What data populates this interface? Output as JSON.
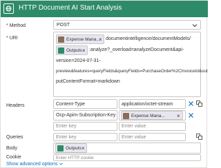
{
  "header": {
    "title": "HTTP Document AI Start Analysis"
  },
  "method": {
    "label": "Method",
    "required": "*",
    "value": "POST"
  },
  "uri": {
    "label": "URI",
    "required": "*",
    "token1": "Expense Mana...",
    "after_token1": "documentintelligence/documentModels/",
    "token2": "Outputs",
    "after_token2": ":analyze?_overload=analyzeDocument&api-",
    "line3": "version=2024-07-31-",
    "line4": "preview&features=queryFields&queryFields=PurchaseOrder%2CInvoiceId&out",
    "line5": "putContentFormat=markdown"
  },
  "headers": {
    "label": "Headers",
    "rows": [
      {
        "key": "Content-Type",
        "value": "application/octet-stream"
      },
      {
        "key": "Ocp-Apim-Subscription-Key",
        "value_token": "Expense Mana..."
      }
    ],
    "key_placeholder": "Enter key",
    "value_placeholder": "Enter value"
  },
  "queries": {
    "label": "Queries",
    "key_placeholder": "Enter key",
    "value_placeholder": "Enter value"
  },
  "body": {
    "label": "Body",
    "token": "Outputs"
  },
  "cookie": {
    "label": "Cookie",
    "placeholder": "Enter HTTP cookie"
  },
  "advanced": {
    "label": "Show advanced options"
  },
  "colors": {
    "header_bg": "#2e8b6a",
    "link": "#0f6cbd",
    "required": "#a4262c",
    "token_bg": "#e7e6f0"
  }
}
